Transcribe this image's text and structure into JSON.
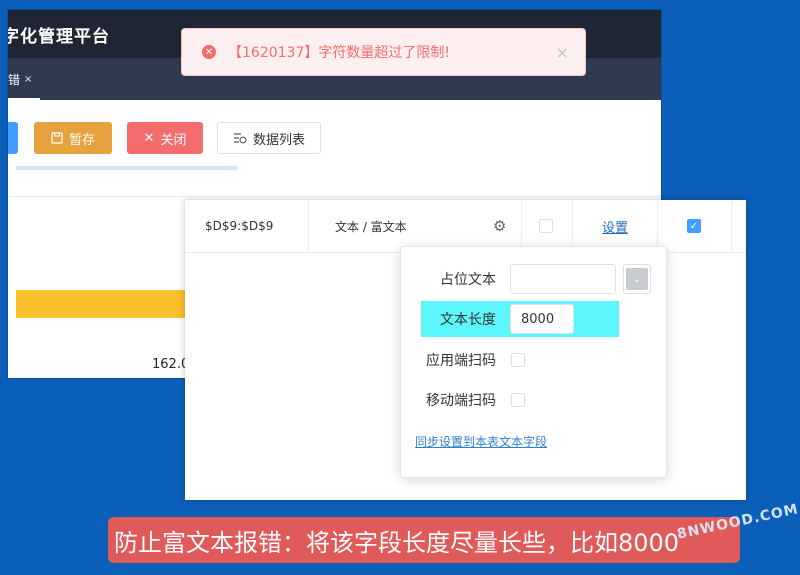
{
  "app": {
    "title": "字化管理平台",
    "tab_label": "错",
    "tab_close": "×"
  },
  "toolbar": {
    "save_label": "暂存",
    "close_label": "关闭",
    "data_list_label": "数据列表"
  },
  "background_cell": "162.0",
  "toast": {
    "message": "【1620137】字符数量超过了限制!",
    "close": "×"
  },
  "grid_row": {
    "cell_ref": "$D$9:$D$9",
    "type": "文本 / 富文本",
    "settings_link": "设置"
  },
  "popover": {
    "placeholder_label": "占位文本",
    "placeholder_value": "",
    "length_label": "文本长度",
    "length_value": "8000",
    "app_scan_label": "应用端扫码",
    "mobile_scan_label": "移动端扫码",
    "sync_link": "同步设置到本表文本字段"
  },
  "caption": "防止富文本报错：将该字段长度尽量长些，比如8000",
  "watermark": "8NWOOD.COM",
  "colors": {
    "bg_blue": "#0b5fb8",
    "highlight": "#5cf7fb",
    "save": "#e6a23c",
    "close": "#f56c6c",
    "caption": "#e05a5a"
  }
}
